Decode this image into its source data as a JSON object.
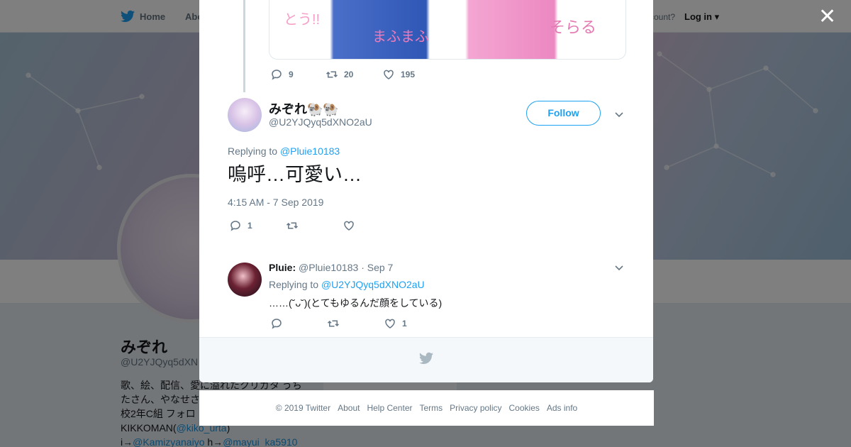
{
  "nav": {
    "home": "Home",
    "about": "Abo",
    "have_account": "ccount?",
    "login": "Log in"
  },
  "profile_bg": {
    "name": "みぞれ",
    "handle": "@U2YJQyq5dXN",
    "bio_line1": "歌、絵、配信、愛に溢れたクリガタ うち",
    "bio_line2": "たさん、やなせさ",
    "bio_line3": "校2年C組 フォロ",
    "bio_line4_pre": "KIKKOMAN(",
    "bio_line4_link": "@kiko_urta",
    "bio_line4_post": ")",
    "bio_line5_a": "i→",
    "bio_line5_link1": "@Kamizyanaiyo",
    "bio_line5_b": " h→",
    "bio_line5_link2": "@mayui_ka5910",
    "ads": "Ads info"
  },
  "modal": {
    "media_scribble1": "とう!!",
    "media_scribble2": "まふまふ",
    "media_scribble3": "そらる",
    "parent_actions": {
      "replies": "9",
      "retweets": "20",
      "likes": "195"
    },
    "main_tweet": {
      "name": "みぞれ🐏🐏",
      "handle": "@U2YJQyq5dXNO2aU",
      "follow": "Follow",
      "replying_prefix": "Replying to ",
      "replying_to": "@Pluie10183",
      "text": "嗚呼…可愛い…",
      "timestamp": "4:15 AM - 7 Sep 2019",
      "replies": "1",
      "retweets": "",
      "likes": ""
    },
    "reply_tweet": {
      "name": "Pluie:",
      "handle": "@Pluie10183",
      "date": "· Sep 7",
      "replying_prefix": "Replying to ",
      "replying_to": "@U2YJQyq5dXNO2aU",
      "text": "……(˘ᴗ˘)(とてもゆるんだ顔をしている)",
      "replies": "",
      "retweets": "",
      "likes": "1"
    }
  },
  "footer": {
    "copyright": "© 2019 Twitter",
    "about": "About",
    "help": "Help Center",
    "terms": "Terms",
    "privacy": "Privacy policy",
    "cookies": "Cookies",
    "ads": "Ads info"
  },
  "colors": {
    "brand": "#1da1f2",
    "muted": "#657786",
    "bg": "#e6ecf0"
  },
  "icons": [
    "twitter-bird-icon",
    "reply-icon",
    "retweet-icon",
    "like-icon",
    "caret-down-icon",
    "close-icon"
  ]
}
